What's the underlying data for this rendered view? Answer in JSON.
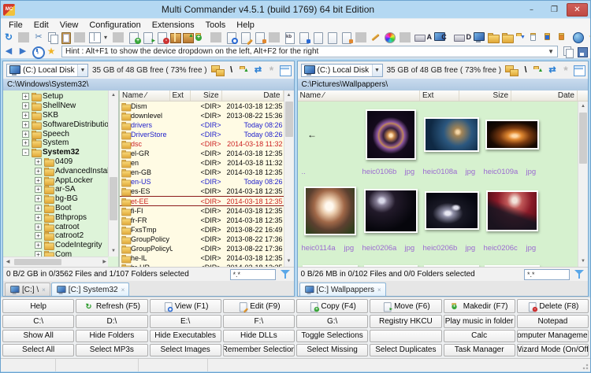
{
  "window": {
    "title": "Multi Commander v4.5.1 (build 1769) 64 bit Edition",
    "minimize": "–",
    "maximize": "❐",
    "close": "✕",
    "app_badge": "MC"
  },
  "colors": {
    "titlebar": "#b4d8f2",
    "close_button": "#bf4a44",
    "toolbar_bg": "#f5f5f5",
    "tree_bg": "#def4d9",
    "file_list_bg": "#fffbe4",
    "thumbs_bg": "#d6f1cf",
    "path_bg": "#b0c9e2",
    "label_purple": "#9b6bd0",
    "recent_blue": "#2222cc",
    "alert_red": "#cc2222",
    "accent_blue": "#3a76c8"
  },
  "menu": {
    "items": [
      {
        "label": "File",
        "name": "menu-file"
      },
      {
        "label": "Edit",
        "name": "menu-edit"
      },
      {
        "label": "View",
        "name": "menu-view"
      },
      {
        "label": "Configuration",
        "name": "menu-configuration"
      },
      {
        "label": "Extensions",
        "name": "menu-extensions"
      },
      {
        "label": "Tools",
        "name": "menu-tools"
      },
      {
        "label": "Help",
        "name": "menu-help"
      }
    ]
  },
  "toolbar1": {
    "icons": [
      {
        "name": "explorer-settings-icon",
        "cls": "k-refresh"
      },
      {
        "name": "separator",
        "cls": "t-sep"
      },
      {
        "name": "cut-icon",
        "cls": "k-scissors"
      },
      {
        "name": "copy-icon",
        "cls": "k-copy"
      },
      {
        "name": "paste-icon",
        "cls": "k-clipboard"
      },
      {
        "name": "separator",
        "cls": "t-sep"
      },
      {
        "name": "split-view-icon",
        "cls": "k-split"
      },
      {
        "name": "split-view-dropdown-icon",
        "cls": "k-caret"
      },
      {
        "name": "separator",
        "cls": "t-sep"
      },
      {
        "name": "new-file-icon",
        "cls": "k-page b-plus"
      },
      {
        "name": "export-file-icon",
        "cls": "k-page b-arrow"
      },
      {
        "name": "delete-file-icon",
        "cls": "k-page b-minus"
      },
      {
        "name": "pack-icon",
        "cls": "k-box"
      },
      {
        "name": "unpack-icon",
        "cls": "k-box b-up"
      },
      {
        "name": "new-folder-icon",
        "cls": "k-folder b-plus"
      },
      {
        "name": "separator",
        "cls": "t-sep"
      },
      {
        "name": "view-file-icon",
        "cls": "k-page b-mag"
      },
      {
        "name": "edit-file-icon",
        "cls": "k-page b-pencil"
      },
      {
        "name": "search-files-icon",
        "cls": "k-page b-mark-orange"
      },
      {
        "name": "separator",
        "cls": "t-sep"
      },
      {
        "name": "kb-icon",
        "cls": "k-kbpage"
      },
      {
        "name": "doc-blue-icon",
        "cls": "k-page b-mark-blue"
      },
      {
        "name": "doc-plain-icon",
        "cls": "k-page"
      },
      {
        "name": "doc-plain2-icon",
        "cls": "k-page"
      },
      {
        "name": "doc-orange-icon",
        "cls": "k-page b-mark-orange"
      },
      {
        "name": "separator",
        "cls": "t-sep"
      },
      {
        "name": "rename-icon",
        "cls": "k-pen"
      },
      {
        "name": "color-settings-icon",
        "cls": "k-colors"
      },
      {
        "name": "separator",
        "cls": "t-sep"
      },
      {
        "name": "drive-a-icon",
        "cls": "k-printer s-A"
      },
      {
        "name": "drive-c-icon",
        "cls": "k-monitor s-C"
      },
      {
        "name": "drive-d-icon",
        "cls": "k-printer s-D"
      },
      {
        "name": "monitor-icon",
        "cls": "k-monitor"
      },
      {
        "name": "folder-favorites1-icon",
        "cls": "k-folder"
      },
      {
        "name": "folder-favorites2-icon",
        "cls": "k-folder"
      },
      {
        "name": "folder-down-icon",
        "cls": "k-folder b-down"
      },
      {
        "name": "folder-doc-icon",
        "cls": "k-folder b-page"
      },
      {
        "name": "folder-disk-icon",
        "cls": "k-folder b-mark-blue"
      },
      {
        "name": "folder-docs-icon",
        "cls": "k-folder b-mark-orange"
      },
      {
        "name": "network-icon",
        "cls": "k-globe"
      },
      {
        "name": "favorites-icon",
        "cls": "k-star"
      },
      {
        "name": "scripting-icon",
        "cls": "k-calc"
      },
      {
        "name": "ftp-icon",
        "cls": "k-ftp"
      },
      {
        "name": "portable-device-icon",
        "cls": "k-phone"
      }
    ]
  },
  "toolbar2": {
    "hint": "Hint : Alt+F1 to show the device dropdown on the left, Alt+F2 for the right",
    "caret": "▼",
    "icons_left": [
      {
        "name": "back-icon",
        "cls": "k-back"
      },
      {
        "name": "forward-icon",
        "cls": "k-fwd"
      },
      {
        "name": "history-icon",
        "cls": "k-clock"
      },
      {
        "name": "favorites-star-icon",
        "cls": "k-star"
      }
    ],
    "icons_right": [
      {
        "name": "copy-path-icon",
        "cls": "k-copy"
      },
      {
        "name": "save-layout-icon",
        "cls": "k-disk"
      }
    ]
  },
  "panel_toolbar": {
    "icons": [
      {
        "name": "folder-tree-toggle-icon",
        "cls": "k-tree"
      },
      {
        "name": "go-root-icon",
        "cls": "k-root"
      },
      {
        "name": "go-parent-icon",
        "cls": "k-folder b-up"
      },
      {
        "name": "reread-source-icon",
        "cls": "k-swap"
      },
      {
        "name": "explode-view-icon",
        "cls": "k-disabled"
      },
      {
        "name": "view-mode-icon",
        "cls": "k-grid"
      }
    ]
  },
  "left_panel": {
    "drive": {
      "label": "(C:) Local Disk",
      "caret": "▼",
      "free_text": "35 GB of 48 GB free ( 73% free )"
    },
    "path": "C:\\Windows\\System32\\",
    "columns": {
      "name": "Name",
      "sort": "⁄",
      "ext": "Ext",
      "size": "Size",
      "date": "Date"
    },
    "tree": [
      {
        "label": "Setup",
        "exp": "+",
        "cls": "lv1"
      },
      {
        "label": "ShellNew",
        "exp": "+",
        "cls": "lv1"
      },
      {
        "label": "SKB",
        "exp": "+",
        "cls": "lv1"
      },
      {
        "label": "SoftwareDistribution",
        "exp": "+",
        "cls": "lv1"
      },
      {
        "label": "Speech",
        "exp": "+",
        "cls": "lv1"
      },
      {
        "label": "System",
        "exp": "+",
        "cls": "lv1"
      },
      {
        "label": "System32",
        "exp": "-",
        "cls": "lv1 bold"
      },
      {
        "label": "0409",
        "exp": "+",
        "cls": "lv2"
      },
      {
        "label": "AdvancedInstallers",
        "exp": "+",
        "cls": "lv2"
      },
      {
        "label": "AppLocker",
        "exp": "+",
        "cls": "lv2"
      },
      {
        "label": "ar-SA",
        "exp": "+",
        "cls": "lv2"
      },
      {
        "label": "bg-BG",
        "exp": "+",
        "cls": "lv2"
      },
      {
        "label": "Boot",
        "exp": "+",
        "cls": "lv2"
      },
      {
        "label": "Bthprops",
        "exp": "+",
        "cls": "lv2"
      },
      {
        "label": "catroot",
        "exp": "+",
        "cls": "lv2"
      },
      {
        "label": "catroot2",
        "exp": "+",
        "cls": "lv2"
      },
      {
        "label": "CodeIntegrity",
        "exp": "+",
        "cls": "lv2"
      },
      {
        "label": "Com",
        "exp": "+",
        "cls": "lv2"
      }
    ],
    "files": [
      {
        "name": "Dism",
        "size": "<DIR>",
        "date": "2014-03-18 12:35",
        "cls": ""
      },
      {
        "name": "downlevel",
        "size": "<DIR>",
        "date": "2013-08-22 15:36",
        "cls": ""
      },
      {
        "name": "drivers",
        "size": "<DIR>",
        "date": "Today 08:26",
        "cls": "c-blue"
      },
      {
        "name": "DriverStore",
        "size": "<DIR>",
        "date": "Today 08:26",
        "cls": "c-blue"
      },
      {
        "name": "dsc",
        "size": "<DIR>",
        "date": "2014-03-18 11:32",
        "cls": "c-red"
      },
      {
        "name": "el-GR",
        "size": "<DIR>",
        "date": "2014-03-18 12:35",
        "cls": ""
      },
      {
        "name": "en",
        "size": "<DIR>",
        "date": "2014-03-18 11:32",
        "cls": ""
      },
      {
        "name": "en-GB",
        "size": "<DIR>",
        "date": "2014-03-18 12:35",
        "cls": ""
      },
      {
        "name": "en-US",
        "size": "<DIR>",
        "date": "Today 08:26",
        "cls": "c-blue"
      },
      {
        "name": "es-ES",
        "size": "<DIR>",
        "date": "2014-03-18 12:35",
        "cls": ""
      },
      {
        "name": "et-EE",
        "size": "<DIR>",
        "date": "2014-03-18 12:35",
        "cls": "c-red cursor"
      },
      {
        "name": "fi-FI",
        "size": "<DIR>",
        "date": "2014-03-18 12:35",
        "cls": ""
      },
      {
        "name": "fr-FR",
        "size": "<DIR>",
        "date": "2014-03-18 12:35",
        "cls": ""
      },
      {
        "name": "FxsTmp",
        "size": "<DIR>",
        "date": "2013-08-22 16:49",
        "cls": ""
      },
      {
        "name": "GroupPolicy",
        "size": "<DIR>",
        "date": "2013-08-22 17:36",
        "cls": ""
      },
      {
        "name": "GroupPolicyUsers",
        "size": "<DIR>",
        "date": "2013-08-22 17:36",
        "cls": ""
      },
      {
        "name": "he-IL",
        "size": "<DIR>",
        "date": "2014-03-18 12:35",
        "cls": ""
      },
      {
        "name": "hr-HR",
        "size": "<DIR>",
        "date": "2014-03-18 12:35",
        "cls": ""
      }
    ],
    "status": "0 B/2 GB in 0/3562 Files and 1/107 Folders selected",
    "filter_value": "*.*",
    "tabs": [
      {
        "label": "[C:] \\",
        "close": "×",
        "cls": ""
      },
      {
        "label": "[C:] System32",
        "close": "×",
        "cls": "on"
      }
    ]
  },
  "right_panel": {
    "drive": {
      "label": "(C:) Local Disk",
      "caret": "▼",
      "free_text": "35 GB of 48 GB free ( 73% free )"
    },
    "path": "C:\\Pictures\\Wallpappers\\",
    "columns": {
      "name": "Name",
      "sort": "⁄",
      "ext": "Ext",
      "size": "Size",
      "date": "Date"
    },
    "items": [
      {
        "name": "..",
        "ext": "",
        "cls": "t-up"
      },
      {
        "name": "heic0106b",
        "ext": "jpg",
        "cls": "t0106b"
      },
      {
        "name": "heic0108a",
        "ext": "jpg",
        "cls": "t0108a"
      },
      {
        "name": "heic0109a",
        "ext": "jpg",
        "cls": "t0109a"
      },
      {
        "name": "heic0114a",
        "ext": "jpg",
        "cls": "t0114a"
      },
      {
        "name": "heic0206a",
        "ext": "jpg",
        "cls": "t0206a"
      },
      {
        "name": "heic0206b",
        "ext": "jpg",
        "cls": "t0206b"
      },
      {
        "name": "heic0206c",
        "ext": "jpg",
        "cls": "t0206c"
      },
      {
        "name": "",
        "ext": "",
        "cls": "tp1"
      },
      {
        "name": "",
        "ext": "",
        "cls": "tp2"
      },
      {
        "name": "",
        "ext": "",
        "cls": "tp3"
      },
      {
        "name": "",
        "ext": "",
        "cls": "tp4"
      }
    ],
    "status": "0 B/26 MB in 0/102 Files and 0/0 Folders selected",
    "filter_value": "*.*",
    "tabs": [
      {
        "label": "[C:] Wallpappers",
        "close": "×",
        "cls": "on"
      }
    ]
  },
  "buttons": [
    {
      "label": "Help",
      "cls": "",
      "name": "help-button"
    },
    {
      "label": "Refresh (F5)",
      "cls": "g-refresh",
      "name": "refresh-button"
    },
    {
      "label": "View (F1)",
      "cls": "k-page b-mag",
      "name": "view-button"
    },
    {
      "label": "Edit (F9)",
      "cls": "k-page b-pencil",
      "name": "edit-button"
    },
    {
      "label": "Copy (F4)",
      "cls": "k-page b-plus",
      "name": "copy-button"
    },
    {
      "label": "Move (F6)",
      "cls": "k-page b-arrow",
      "name": "move-button"
    },
    {
      "label": "Makedir (F7)",
      "cls": "k-folder b-plus",
      "name": "makedir-button"
    },
    {
      "label": "Delete (F8)",
      "cls": "k-page b-minus",
      "name": "delete-button"
    },
    {
      "label": "C:\\",
      "cls": "",
      "name": "drive-c-button"
    },
    {
      "label": "D:\\",
      "cls": "",
      "name": "drive-d-button"
    },
    {
      "label": "E:\\",
      "cls": "",
      "name": "drive-e-button"
    },
    {
      "label": "F:\\",
      "cls": "",
      "name": "drive-f-button"
    },
    {
      "label": "G:\\",
      "cls": "",
      "name": "drive-g-button"
    },
    {
      "label": "Registry HKCU",
      "cls": "",
      "name": "registry-hkcu-button"
    },
    {
      "label": "Play music in folder",
      "cls": "",
      "name": "play-music-button"
    },
    {
      "label": "Notepad",
      "cls": "",
      "name": "notepad-button"
    },
    {
      "label": "Show All",
      "cls": "",
      "name": "show-all-button"
    },
    {
      "label": "Hide Folders",
      "cls": "",
      "name": "hide-folders-button"
    },
    {
      "label": "Hide Executables",
      "cls": "",
      "name": "hide-executables-button"
    },
    {
      "label": "Hide DLLs",
      "cls": "",
      "name": "hide-dlls-button"
    },
    {
      "label": "Toggle Selections",
      "cls": "",
      "name": "toggle-selections-button"
    },
    {
      "label": "",
      "cls": "",
      "name": "empty-button"
    },
    {
      "label": "Calc",
      "cls": "",
      "name": "calc-button"
    },
    {
      "label": "Computer Management",
      "cls": "",
      "name": "computer-management-button"
    },
    {
      "label": "Select All",
      "cls": "",
      "name": "select-all-button"
    },
    {
      "label": "Select MP3s",
      "cls": "",
      "name": "select-mp3s-button"
    },
    {
      "label": "Select Images",
      "cls": "",
      "name": "select-images-button"
    },
    {
      "label": "Remember Selection",
      "cls": "",
      "name": "remember-selection-button"
    },
    {
      "label": "Select Missing",
      "cls": "",
      "name": "select-missing-button"
    },
    {
      "label": "Select Duplicates",
      "cls": "",
      "name": "select-duplicates-button"
    },
    {
      "label": "Task Manager",
      "cls": "",
      "name": "task-manager-button"
    },
    {
      "label": "Wizard Mode (On/Off)",
      "cls": "",
      "name": "wizard-mode-button"
    }
  ]
}
